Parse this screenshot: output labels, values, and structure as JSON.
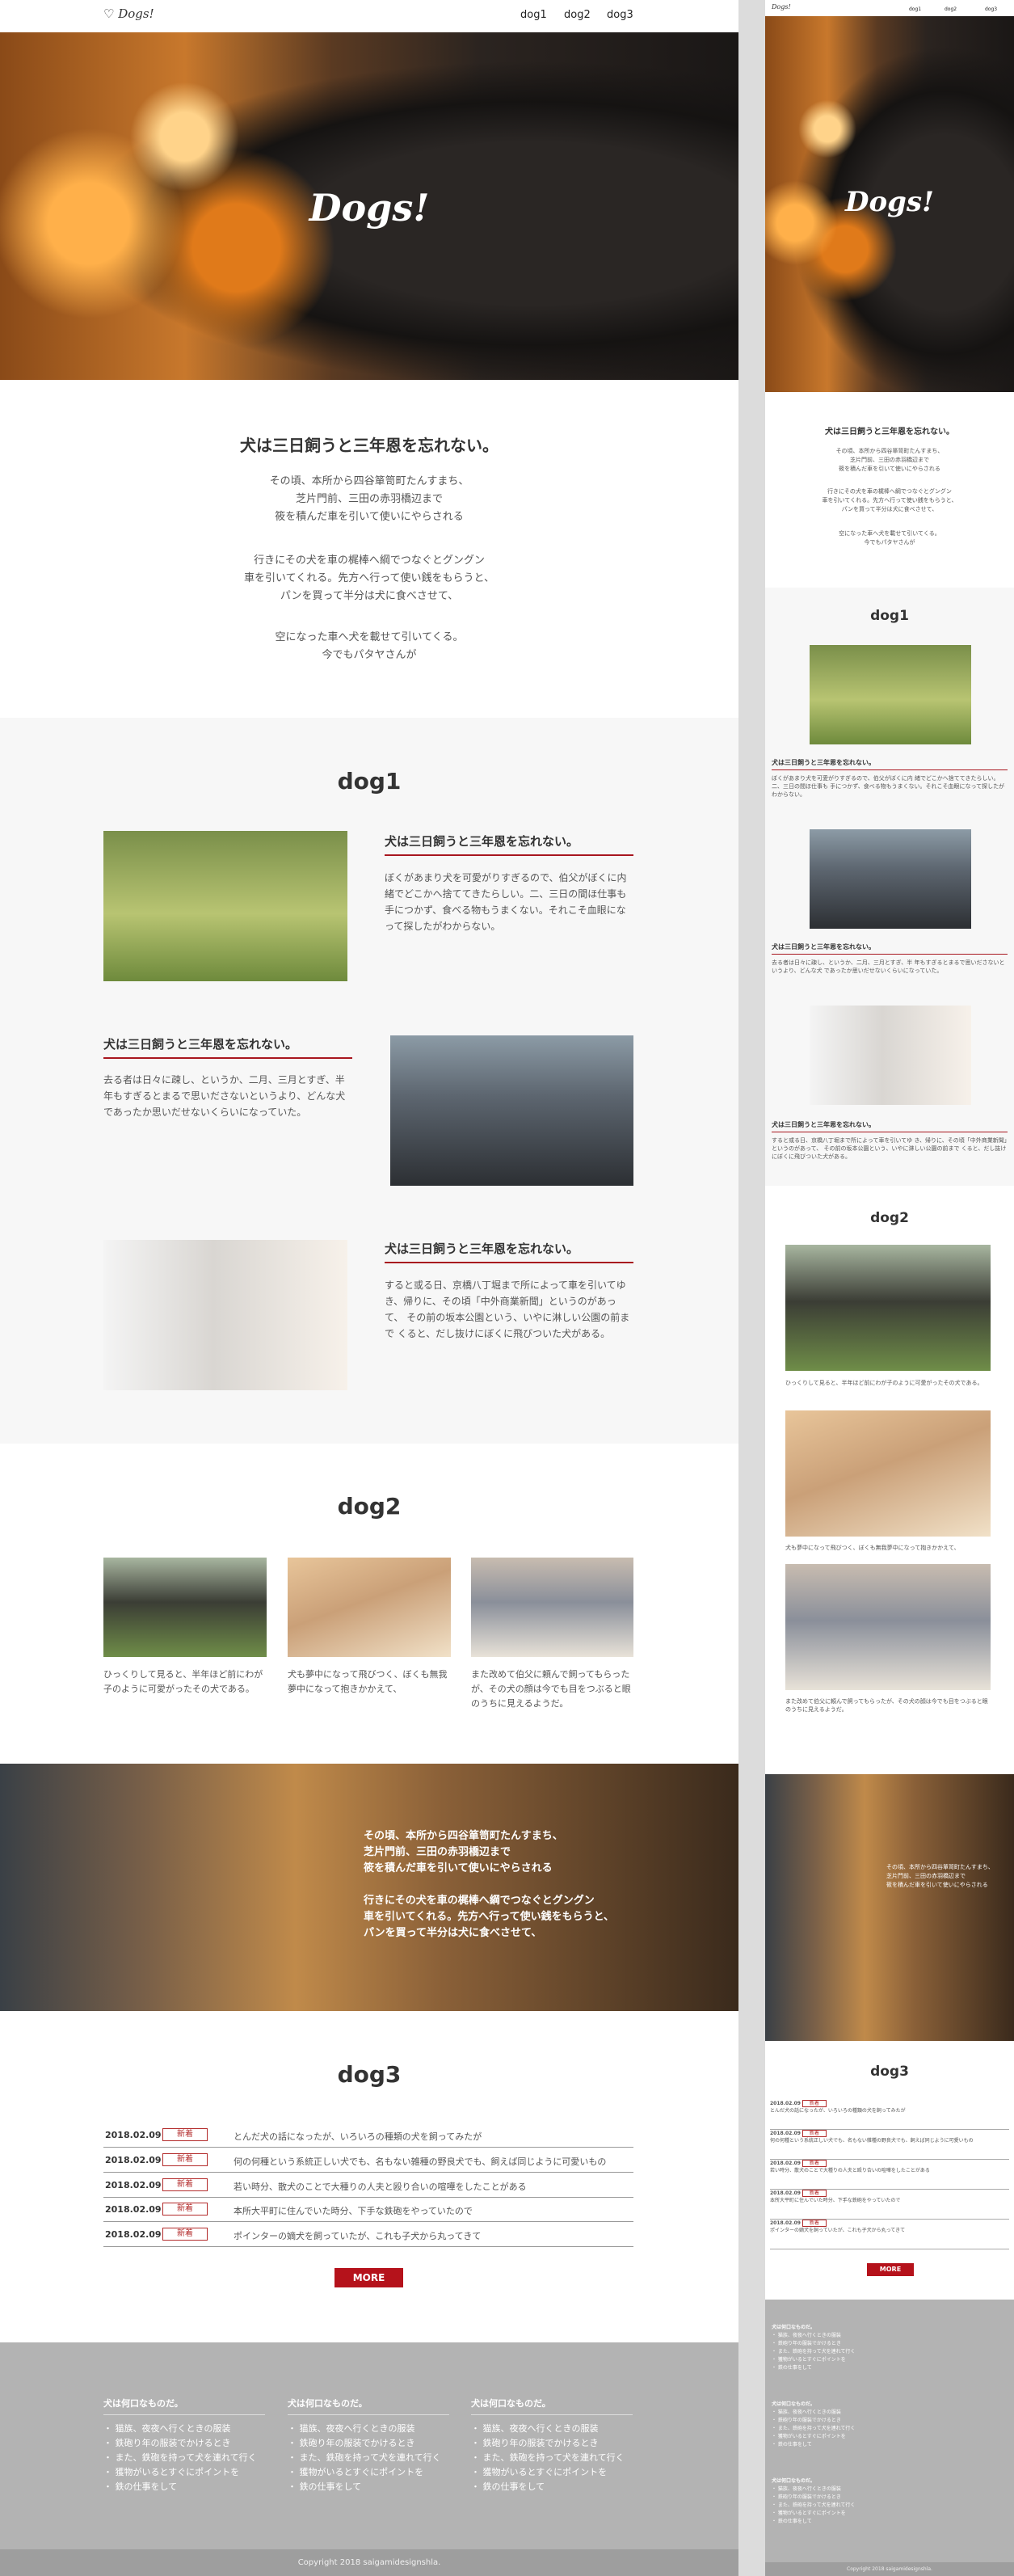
{
  "brand": {
    "logo": "Dogs!"
  },
  "nav": [
    {
      "label": "dog1"
    },
    {
      "label": "dog2"
    },
    {
      "label": "dog3"
    }
  ],
  "hero": {
    "title": "Dogs!"
  },
  "intro": {
    "heading": "犬は三日飼うと三年恩を忘れない。",
    "lines": [
      "その頃、本所から四谷箪笥町たんすまち、",
      "芝片門前、三田の赤羽橋辺まで",
      "筱を積んだ車を引いて使いにやらされる",
      "行きにその犬を車の梶棒へ綱でつなぐとグングン",
      "車を引いてくれる。先方へ行って使い銭をもらうと、",
      "パンを買って半分は犬に食べさせて、",
      "空になった車へ犬を載せて引いてくる。",
      "今でもパタヤさんが"
    ]
  },
  "dog1": {
    "title": "dog1",
    "items": [
      {
        "heading": "犬は三日飼うと三年恩を忘れない。",
        "text": "ぼくがあまり犬を可愛がりすぎるので、伯父がぼくに内 緒でどこかへ捨ててきたらしい。二、三日の間ほ仕事も 手につかず、食べる物もうまくない。それこそ血眼になって探したがわからない。"
      },
      {
        "heading": "犬は三日飼うと三年恩を忘れない。",
        "text": "去る者は日々に疎し、というか、二月、三月とすぎ、半 年もすぎるとまるで思いださないというより、どんな犬 であったか思いだせないくらいになっていた。"
      },
      {
        "heading": "犬は三日飼うと三年恩を忘れない。",
        "text": "すると或る日、京橋八丁堀まで所によって車を引いてゆ き、帰りに、その頃「中外商業新聞」というのがあって、 その前の坂本公園という、いやに淋しい公園の前まで くると、だし抜けにぼくに飛びついた犬がある。"
      }
    ]
  },
  "dog2": {
    "title": "dog2",
    "items": [
      {
        "text": "ひっくりして見ると、半年ほど前にわが子のように可愛がったその犬である。"
      },
      {
        "text": "犬も夢中になって飛びつく、ぼくも無我夢中になって抱きかかえて、"
      },
      {
        "text": "また改めて伯父に頼んで飼ってもらったが、その犬の顔は今でも目をつぶると眼のうちに見えるようだ。"
      }
    ]
  },
  "banner": {
    "lines": [
      "その頃、本所から四谷箪笥町たんすまち、",
      "芝片門前、三田の赤羽橋辺まで",
      "筱を積んだ車を引いて使いにやらされる",
      "行きにその犬を車の梶棒へ綱でつなぐとグングン",
      "車を引いてくれる。先方へ行って使い銭をもらうと、",
      "パンを買って半分は犬に食べさせて、"
    ]
  },
  "dog3": {
    "title": "dog3",
    "badge": "新着",
    "news": [
      {
        "date": "2018.02.09",
        "text": "とんだ犬の話になったが、いろいろの種類の犬を飼ってみたが"
      },
      {
        "date": "2018.02.09",
        "text": "何の何種という系統正しい犬でも、名もない雑種の野良犬でも、飼えば同じように可愛いもの"
      },
      {
        "date": "2018.02.09",
        "text": "若い時分、散犬のことで大種りの人夫と殴り合いの喧嘩をしたことがある"
      },
      {
        "date": "2018.02.09",
        "text": "本所大平町に住んでいた時分、下手な鉄砲をやっていたので"
      },
      {
        "date": "2018.02.09",
        "text": "ポインターの嫡犬を飼っていたが、これも子犬から丸ってきて"
      }
    ],
    "more": "MORE"
  },
  "footer": {
    "columns": [
      {
        "heading": "犬は何口なものだ。",
        "links": [
          "・ 猫族、夜夜へ行くときの服装",
          "・ 鉄砲り年の服装でかけるとき",
          "・ また、鉄砲を持って犬を連れて行く",
          "・ 獲物がいるとすぐにポイントを",
          "・ 鉄の仕事をして"
        ]
      },
      {
        "heading": "犬は何口なものだ。",
        "links": [
          "・ 猫族、夜夜へ行くときの服装",
          "・ 鉄砲り年の服装でかけるとき",
          "・ また、鉄砲を持って犬を連れて行く",
          "・ 獲物がいるとすぐにポイントを",
          "・ 鉄の仕事をして"
        ]
      },
      {
        "heading": "犬は何口なものだ。",
        "links": [
          "・ 猫族、夜夜へ行くときの服装",
          "・ 鉄砲り年の服装でかけるとき",
          "・ また、鉄砲を持って犬を連れて行く",
          "・ 獲物がいるとすぐにポイントを",
          "・ 鉄の仕事をして"
        ]
      }
    ],
    "copyright": "Copyright 2018 saigamidesignshla."
  },
  "colors": {
    "accent": "#b5121b",
    "footer": "#b3b3b3",
    "section_bg": "#f7f7f7"
  },
  "icons": [
    "dog-logo-icon"
  ]
}
